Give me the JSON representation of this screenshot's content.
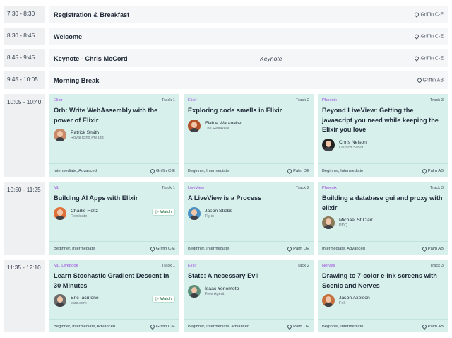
{
  "simple_rows": [
    {
      "time": "7:30 - 8:30",
      "title": "Registration & Breakfast",
      "mid": "",
      "location": "Griffin C-E"
    },
    {
      "time": "8:30 - 8:45",
      "title": "Welcome",
      "mid": "",
      "location": "Griffin C-E"
    },
    {
      "time": "8:45 - 9:45",
      "title": "Keynote - Chris McCord",
      "mid": "Keynote",
      "location": "Griffin C-E"
    },
    {
      "time": "9:45 - 10:05",
      "title": "Morning Break",
      "mid": "",
      "location": "Griffin AB"
    }
  ],
  "sessions": [
    {
      "time": "10:05 - 10:40",
      "cards": [
        {
          "tag": "Elixir",
          "track": "Track 1",
          "title": "Orb: Write WebAssembly with the power of Elixir",
          "speaker": "Patrick Smith",
          "company": "Royal Icing Pty Ltd",
          "level": "Intermediate, Advanced",
          "location": "Griffin C-E",
          "watch": "",
          "avatar_bg": "#c98a6b"
        },
        {
          "tag": "Elixir",
          "track": "Track 2",
          "title": "Exploring code smells in Elixir",
          "speaker": "Elaine Watanabe",
          "company": "The RealReal",
          "level": "Beginner, Intermediate",
          "location": "Palm DE",
          "watch": "",
          "avatar_bg": "#b4532a"
        },
        {
          "tag": "Phoenix",
          "track": "Track 3",
          "title": "Beyond LiveView: Getting the javascript you need while keeping the Elixir you love",
          "speaker": "Chris Nelson",
          "company": "Launch Scout",
          "level": "Beginner, Intermediate",
          "location": "Palm AB",
          "watch": "",
          "avatar_bg": "#222222"
        }
      ]
    },
    {
      "time": "10:50 - 11:25",
      "cards": [
        {
          "tag": "ML",
          "track": "Track 1",
          "title": "Building AI Apps with Elixir",
          "speaker": "Charlie Holtz",
          "company": "Replicate",
          "level": "Beginner, Intermediate",
          "location": "Griffin C-E",
          "watch": "Watch",
          "avatar_bg": "#e0713a"
        },
        {
          "tag": "LiveView",
          "track": "Track 2",
          "title": "A LiveView is a Process",
          "speaker": "Jason Stiebs",
          "company": "Fly.io",
          "level": "Beginner, Intermediate",
          "location": "Palm DE",
          "watch": "",
          "avatar_bg": "#4a90c2"
        },
        {
          "tag": "Phoenix",
          "track": "Track 3",
          "title": "Building a database gui and proxy with elixir",
          "speaker": "Michael St Clair",
          "company": "PDQ",
          "level": "Intermediate, Advanced",
          "location": "Palm AB",
          "watch": "",
          "avatar_bg": "#8a7a5a"
        }
      ]
    },
    {
      "time": "11:35 - 12:10",
      "cards": [
        {
          "tag": "ML, Livebook",
          "track": "Track 1",
          "title": "Learn Stochastic Gradient Descent in 30 Minutes",
          "speaker": "Eric Iacutone",
          "company": "cars.com",
          "level": "Beginner, Intermediate, Advanced",
          "location": "Griffin C-E",
          "watch": "Watch",
          "avatar_bg": "#6b6b6b"
        },
        {
          "tag": "Elixir",
          "track": "Track 2",
          "title": "State: A necessary Evil",
          "speaker": "Isaac Yonemoto",
          "company": "Free Agent",
          "level": "Beginner, Intermediate, Advanced",
          "location": "Palm DE",
          "watch": "",
          "avatar_bg": "#5f8f7a"
        },
        {
          "tag": "Nerves",
          "track": "Track 3",
          "title": "Drawing to 7-color e-ink screens with Scenic and Nerves",
          "speaker": "Jason Axelson",
          "company": "Felt",
          "level": "Beginner, Intermediate",
          "location": "Palm AB",
          "watch": "",
          "avatar_bg": "#c4713f"
        }
      ]
    }
  ],
  "colors": {
    "card_bg": "#d7f0ec",
    "tag": "#9d4edd",
    "row_bg": "#f5f6f7",
    "time_bg": "#eef0f2"
  }
}
